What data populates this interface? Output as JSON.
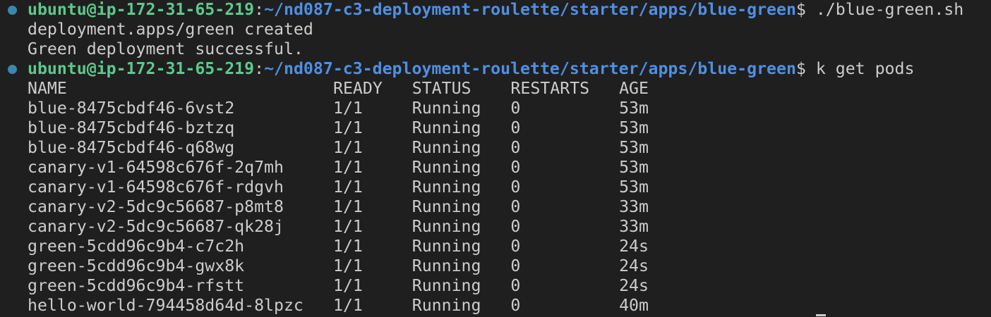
{
  "colors": {
    "background": "#1f1f1f",
    "user": "#5cc98d",
    "path": "#4f8fe3",
    "text": "#cccccc",
    "status_dot": "#3a87b0"
  },
  "prompt1": {
    "user": "ubuntu@ip-172-31-65-219",
    "sep": ":",
    "path": "~/nd087-c3-deployment-roulette/starter/apps/blue-green",
    "symbol": "$ ",
    "command": "./blue-green.sh"
  },
  "output": [
    "deployment.apps/green created",
    "Green deployment successful."
  ],
  "prompt2": {
    "user": "ubuntu@ip-172-31-65-219",
    "sep": ":",
    "path": "~/nd087-c3-deployment-roulette/starter/apps/blue-green",
    "symbol": "$ ",
    "command": "k get pods"
  },
  "table": {
    "headers": [
      "NAME",
      "READY",
      "STATUS",
      "RESTARTS",
      "AGE"
    ],
    "rows": [
      [
        "blue-8475cbdf46-6vst2",
        "1/1",
        "Running",
        "0",
        "53m"
      ],
      [
        "blue-8475cbdf46-bztzq",
        "1/1",
        "Running",
        "0",
        "53m"
      ],
      [
        "blue-8475cbdf46-q68wg",
        "1/1",
        "Running",
        "0",
        "53m"
      ],
      [
        "canary-v1-64598c676f-2q7mh",
        "1/1",
        "Running",
        "0",
        "53m"
      ],
      [
        "canary-v1-64598c676f-rdgvh",
        "1/1",
        "Running",
        "0",
        "53m"
      ],
      [
        "canary-v2-5dc9c56687-p8mt8",
        "1/1",
        "Running",
        "0",
        "33m"
      ],
      [
        "canary-v2-5dc9c56687-qk28j",
        "1/1",
        "Running",
        "0",
        "33m"
      ],
      [
        "green-5cdd96c9b4-c7c2h",
        "1/1",
        "Running",
        "0",
        "24s"
      ],
      [
        "green-5cdd96c9b4-gwx8k",
        "1/1",
        "Running",
        "0",
        "24s"
      ],
      [
        "green-5cdd96c9b4-rfstt",
        "1/1",
        "Running",
        "0",
        "24s"
      ],
      [
        "hello-world-794458d64d-8lpzc",
        "1/1",
        "Running",
        "0",
        "40m"
      ]
    ]
  }
}
